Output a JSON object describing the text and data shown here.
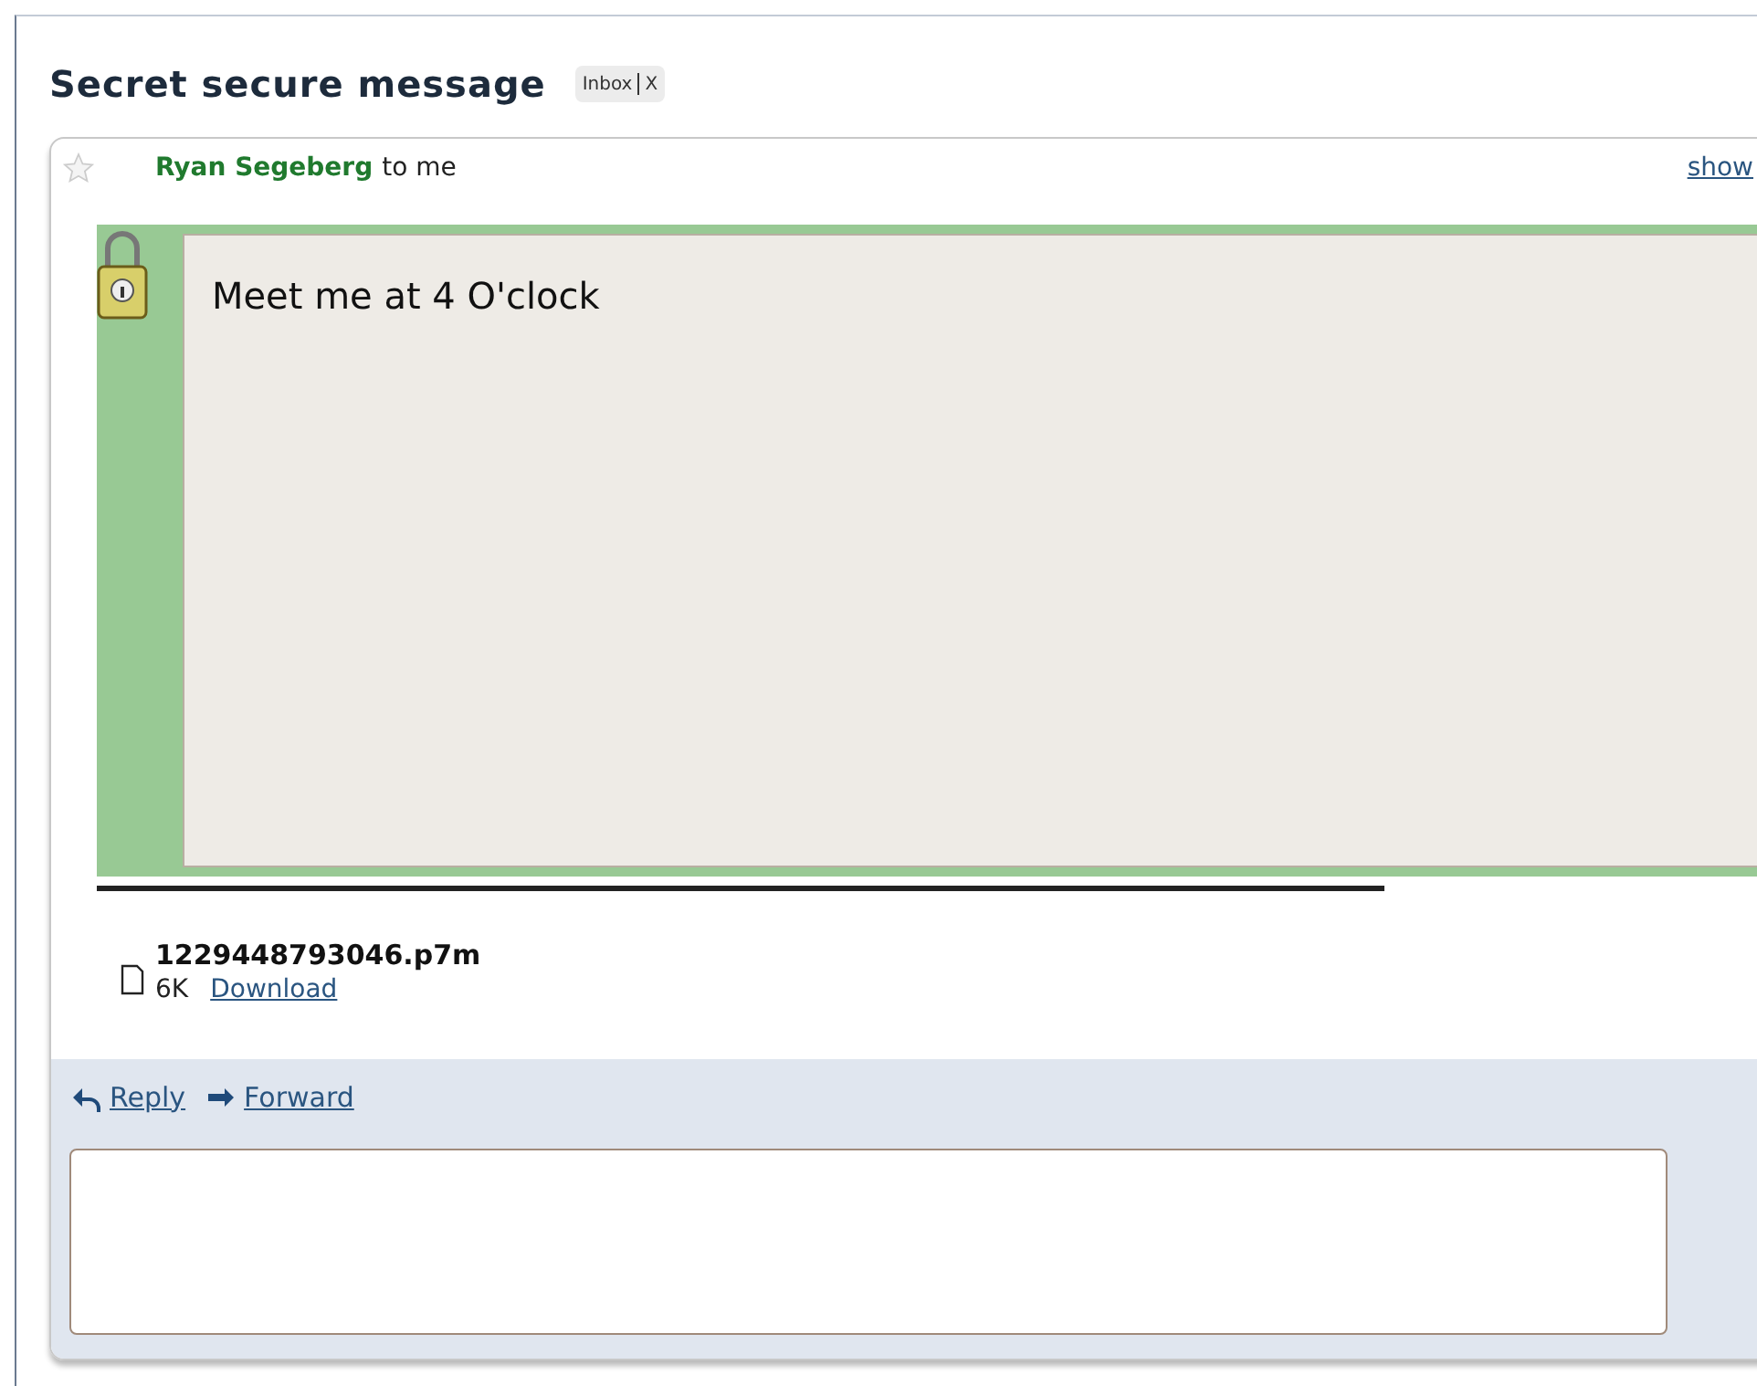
{
  "subject": "Secret secure message",
  "labels": [
    {
      "text": "Inbox"
    },
    {
      "text": "X"
    }
  ],
  "message": {
    "starred": false,
    "sender": "Ryan Segeberg",
    "recipient": "to me",
    "details_link": "show",
    "body": "Meet me at 4 O'clock",
    "encrypted": true
  },
  "attachment": {
    "filename": "1229448793046.p7m",
    "size": "6K",
    "download": "Download"
  },
  "actions": [
    {
      "kind": "reply",
      "label": "Reply"
    },
    {
      "kind": "forward",
      "label": "Forward"
    }
  ]
}
